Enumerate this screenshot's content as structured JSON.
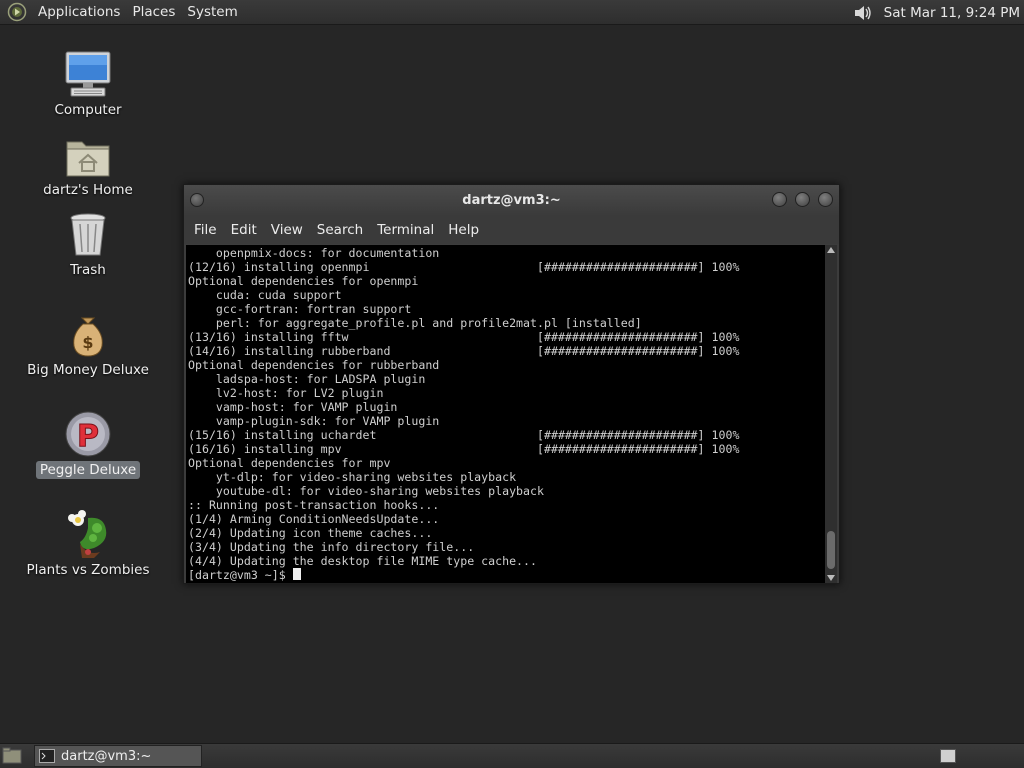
{
  "top_panel": {
    "menus": [
      "Applications",
      "Places",
      "System"
    ],
    "clock": "Sat Mar 11,  9:24 PM"
  },
  "desktop": {
    "icons": [
      {
        "label": "Computer",
        "icon": "computer-icon"
      },
      {
        "label": "dartz's Home",
        "icon": "home-folder-icon"
      },
      {
        "label": "Trash",
        "icon": "trash-icon"
      },
      {
        "label": "Big Money Deluxe",
        "icon": "money-bag-icon"
      },
      {
        "label": "Peggle Deluxe",
        "icon": "peggle-icon",
        "selected": true
      },
      {
        "label": "Plants vs Zombies",
        "icon": "plants-vs-zombies-icon"
      }
    ]
  },
  "terminal": {
    "title": "dartz@vm3:~",
    "menu": [
      "File",
      "Edit",
      "View",
      "Search",
      "Terminal",
      "Help"
    ],
    "lines": [
      "    openpmix-docs: for documentation",
      "(12/16) installing openmpi                        [######################] 100%",
      "Optional dependencies for openmpi",
      "    cuda: cuda support",
      "    gcc-fortran: fortran support",
      "    perl: for aggregate_profile.pl and profile2mat.pl [installed]",
      "(13/16) installing fftw                           [######################] 100%",
      "(14/16) installing rubberband                     [######################] 100%",
      "Optional dependencies for rubberband",
      "    ladspa-host: for LADSPA plugin",
      "    lv2-host: for LV2 plugin",
      "    vamp-host: for VAMP plugin",
      "    vamp-plugin-sdk: for VAMP plugin",
      "(15/16) installing uchardet                       [######################] 100%",
      "(16/16) installing mpv                            [######################] 100%",
      "Optional dependencies for mpv",
      "    yt-dlp: for video-sharing websites playback",
      "    youtube-dl: for video-sharing websites playback",
      ":: Running post-transaction hooks...",
      "(1/4) Arming ConditionNeedsUpdate...",
      "(2/4) Updating icon theme caches...",
      "(3/4) Updating the info directory file...",
      "(4/4) Updating the desktop file MIME type cache..."
    ],
    "prompt": "[dartz@vm3 ~]$ "
  },
  "bottom_panel": {
    "task_label": "dartz@vm3:~"
  }
}
